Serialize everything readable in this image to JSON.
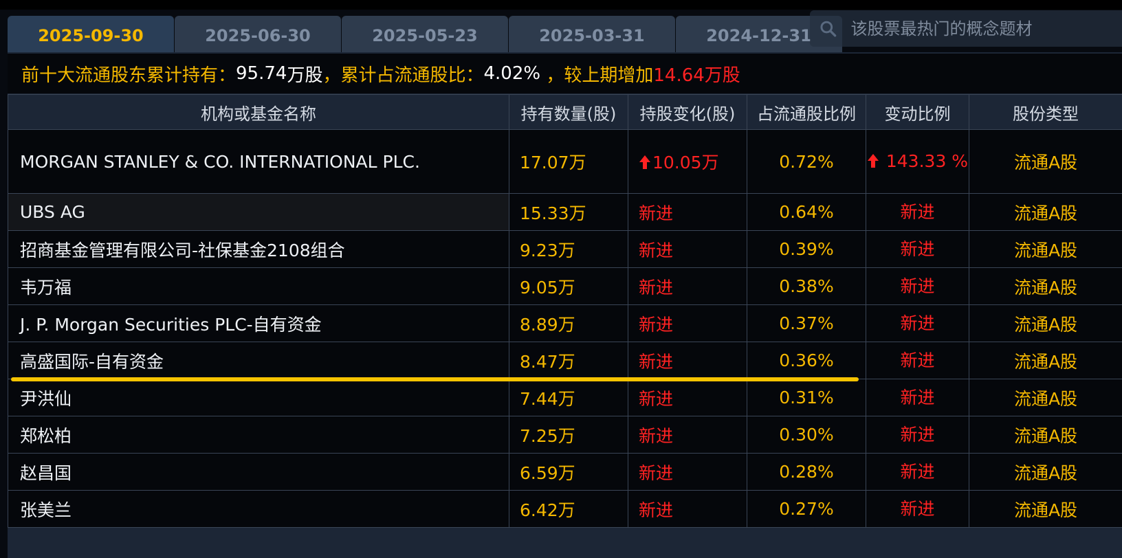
{
  "tabs": [
    {
      "label": "2025-09-30",
      "active": true
    },
    {
      "label": "2025-06-30",
      "active": false
    },
    {
      "label": "2025-05-23",
      "active": false
    },
    {
      "label": "2025-03-31",
      "active": false
    },
    {
      "label": "2024-12-31",
      "active": false
    }
  ],
  "search": {
    "placeholder": "该股票最热门的概念题材"
  },
  "summary": {
    "prefix": "前十大流通股东累计持有：",
    "total_holding": "95.74",
    "unit_shares": "万股",
    "ratio_label": "，累计占流通股比：",
    "ratio_value": "4.02%",
    "change_label": " ，较上期增加",
    "change_value": "14.64万股"
  },
  "table": {
    "columns": [
      "机构或基金名称",
      "持有数量(股)",
      "持股变化(股)",
      "占流通股比例",
      "变动比例",
      "股份类型"
    ],
    "rows": [
      {
        "name": "MORGAN STANLEY & CO. INTERNATIONAL PLC.",
        "qty": "17.07万",
        "change": "10.05万",
        "change_up": true,
        "pct": "0.72%",
        "ratio": "143.33 %",
        "ratio_up": true,
        "type": "流通A股"
      },
      {
        "name": "UBS AG",
        "qty": "15.33万",
        "change": "新进",
        "pct": "0.64%",
        "ratio": "新进",
        "type": "流通A股"
      },
      {
        "name": "招商基金管理有限公司-社保基金2108组合",
        "qty": "9.23万",
        "change": "新进",
        "pct": "0.39%",
        "ratio": "新进",
        "type": "流通A股"
      },
      {
        "name": "韦万福",
        "qty": "9.05万",
        "change": "新进",
        "pct": "0.38%",
        "ratio": "新进",
        "type": "流通A股"
      },
      {
        "name": "J. P. Morgan Securities PLC-自有资金",
        "qty": "8.89万",
        "change": "新进",
        "pct": "0.37%",
        "ratio": "新进",
        "type": "流通A股"
      },
      {
        "name": "高盛国际-自有资金",
        "qty": "8.47万",
        "change": "新进",
        "pct": "0.36%",
        "ratio": "新进",
        "type": "流通A股"
      },
      {
        "name": "尹洪仙",
        "qty": "7.44万",
        "change": "新进",
        "pct": "0.31%",
        "ratio": "新进",
        "type": "流通A股"
      },
      {
        "name": "郑松柏",
        "qty": "7.25万",
        "change": "新进",
        "pct": "0.30%",
        "ratio": "新进",
        "type": "流通A股"
      },
      {
        "name": "赵昌国",
        "qty": "6.59万",
        "change": "新进",
        "pct": "0.28%",
        "ratio": "新进",
        "type": "流通A股"
      },
      {
        "name": "张美兰",
        "qty": "6.42万",
        "change": "新进",
        "pct": "0.27%",
        "ratio": "新进",
        "type": "流通A股"
      }
    ]
  },
  "colors": {
    "accent": "#f5b800",
    "up": "#ff2222",
    "highlight": "#f7c400"
  },
  "icons": {
    "search": "search-icon",
    "up_arrow": "arrow-up-icon"
  }
}
